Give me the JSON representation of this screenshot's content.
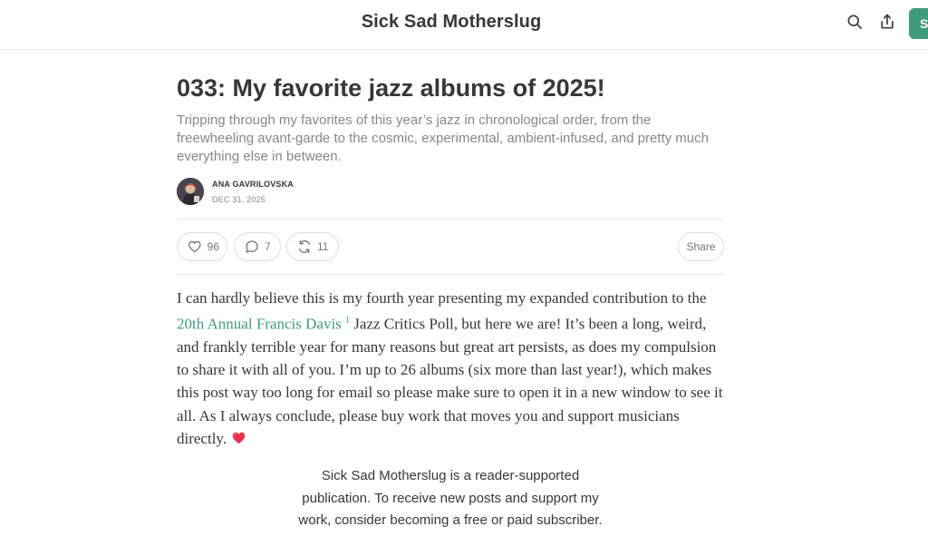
{
  "header": {
    "site_title": "Sick Sad Motherslug",
    "subscribe_label": "Su",
    "icons": [
      "search-icon",
      "share-upload-icon"
    ]
  },
  "post": {
    "title": "033: My favorite jazz albums of 2025!",
    "subtitle": "Tripping through my favorites of this year’s jazz in chronological order, from the freewheeling avant-garde to the cosmic, experimental, ambient-infused, and pretty much everything else in between.",
    "author": "ANA GAVRILOVSKA",
    "date": "DEC 31, 2025"
  },
  "actions": {
    "likes": "96",
    "comments": "7",
    "restacks": "11",
    "share_label": "Share"
  },
  "body": {
    "p1_before": "I can hardly believe this is my fourth year presenting my expanded contribution to the ",
    "link_text": "20th Annual Francis Davis",
    "footnote": "1",
    "p1_after": " Jazz Critics Poll, but here we are! It’s been a long, weird, and frankly terrible year for many reasons but great art persists, as does my compulsion to share it with all of you. I’m up to 26 albums (six more than last year!), which makes this post way too long for email so please make sure to open it in a new window to see it all. As I always conclude, please buy work that moves you and support musicians directly.",
    "emoji": "heart-emoji"
  },
  "subscribe_blurb": "Sick Sad Motherslug is a reader-supported publication. To receive new posts and support my work, consider becoming a free or paid subscriber.",
  "colors": {
    "accent": "#3f9b7b",
    "text": "#363737",
    "muted": "#868787",
    "border": "#e8e8e8"
  }
}
